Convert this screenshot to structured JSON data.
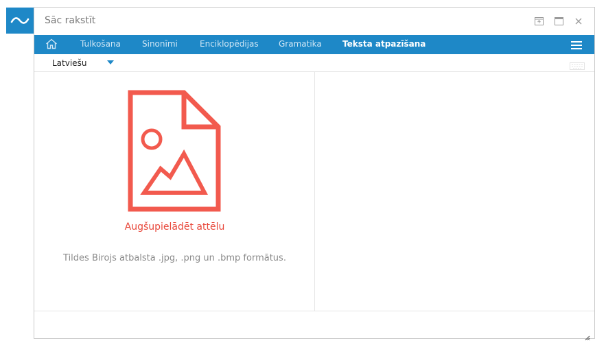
{
  "logo": {
    "icon": "tilde-logo-icon"
  },
  "window": {
    "title": "Sāc rakstīt",
    "controls": [
      "pin-window-icon",
      "maximize-icon",
      "close-icon"
    ]
  },
  "nav": {
    "home_icon": "home-icon",
    "tabs": [
      {
        "label": "Tulkošana",
        "active": false
      },
      {
        "label": "Sinonīmi",
        "active": false
      },
      {
        "label": "Enciklopēdijas",
        "active": false
      },
      {
        "label": "Gramatika",
        "active": false
      },
      {
        "label": "Teksta atpazīšana",
        "active": true
      }
    ],
    "menu_icon": "hamburger-menu-icon"
  },
  "toolbar": {
    "language": "Latviešu",
    "keyboard_icon": "keyboard-icon"
  },
  "upload": {
    "link_label": "Augšupielādēt attēlu",
    "hint": "Tildes Birojs atbalsta .jpg, .png un .bmp formātus."
  },
  "colors": {
    "brand": "#1e88c7",
    "accent": "#e8473a",
    "icon": "#f25a4e"
  }
}
